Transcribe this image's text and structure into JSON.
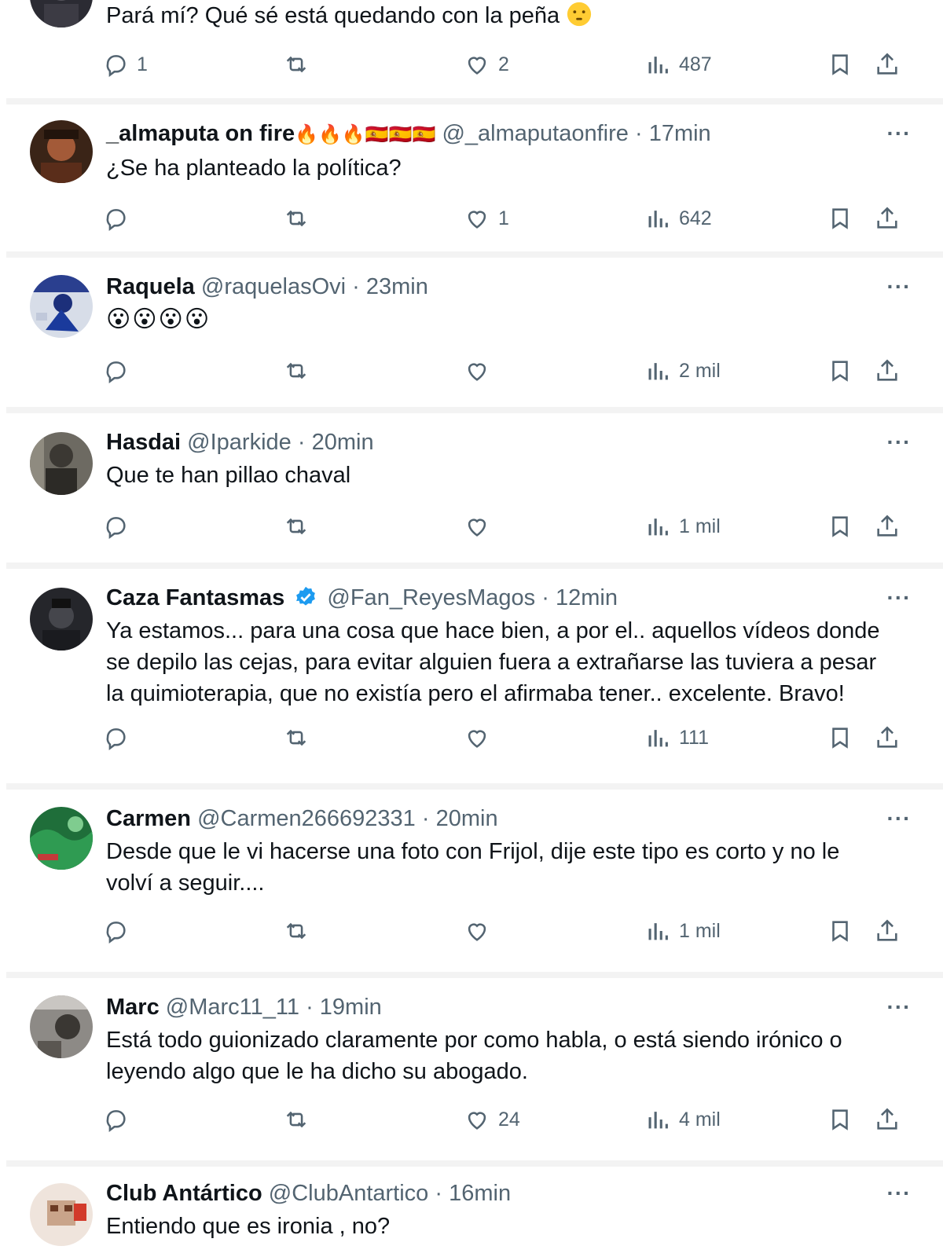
{
  "icons": {
    "reply": "reply-icon",
    "retweet": "retweet-icon",
    "like": "heart-icon",
    "views": "views-icon",
    "bookmark": "bookmark-icon",
    "share": "share-icon",
    "more": "more-icon"
  },
  "colors": {
    "text": "#0f1419",
    "muted": "#536471",
    "verified": "#1d9bf0",
    "separator": "#f3f3f3"
  },
  "more_label": "···",
  "posts": [
    {
      "body": "Pará mí? Qué sé está quedando con la peña",
      "body_emoji": "🤫",
      "replies": "1",
      "likes": "2",
      "views": "487"
    },
    {
      "name": "_almaputa on fire",
      "name_emojis": "🔥🔥🔥🇪🇸🇪🇸🇪🇸",
      "handle": "@_almaputaonfire",
      "time": "17min",
      "body": "¿Se ha planteado la política?",
      "replies": "",
      "likes": "1",
      "views": "642"
    },
    {
      "name": "Raquela",
      "handle": "@raquelasOvi",
      "time": "23min",
      "body": "😮😮😮😮",
      "replies": "",
      "likes": "",
      "views": "2 mil"
    },
    {
      "name": "Hasdai",
      "handle": "@Iparkide",
      "time": "20min",
      "body": "Que te han pillao chaval",
      "replies": "",
      "likes": "",
      "views": "1 mil"
    },
    {
      "name": "Caza Fantasmas",
      "verified": true,
      "handle": "@Fan_ReyesMagos",
      "time": "12min",
      "body_lines": [
        "Ya estamos... para una cosa que hace bien, a por el.. aquellos vídeos donde",
        "se depilo las cejas, para evitar alguien fuera a extrañarse las tuviera a pesar",
        "la quimioterapia, que no existía pero el afirmaba tener.. excelente. Bravo!"
      ],
      "replies": "",
      "likes": "",
      "views": "111"
    },
    {
      "name": "Carmen",
      "handle": "@Carmen266692331",
      "time": "20min",
      "body_lines": [
        "Desde que le vi hacerse una foto con Frijol, dije este tipo es corto y no le",
        "volví a seguir...."
      ],
      "replies": "",
      "likes": "",
      "views": "1 mil"
    },
    {
      "name": "Marc",
      "handle": "@Marc11_11",
      "time": "19min",
      "body_lines": [
        "Está todo guionizado claramente por como habla, o está siendo irónico o",
        "leyendo algo que le ha dicho su abogado."
      ],
      "replies": "",
      "likes": "24",
      "views": "4 mil"
    },
    {
      "name": "Club Antártico",
      "handle": "@ClubAntartico",
      "time": "16min",
      "body": "Entiendo que es ironia , no?"
    }
  ]
}
